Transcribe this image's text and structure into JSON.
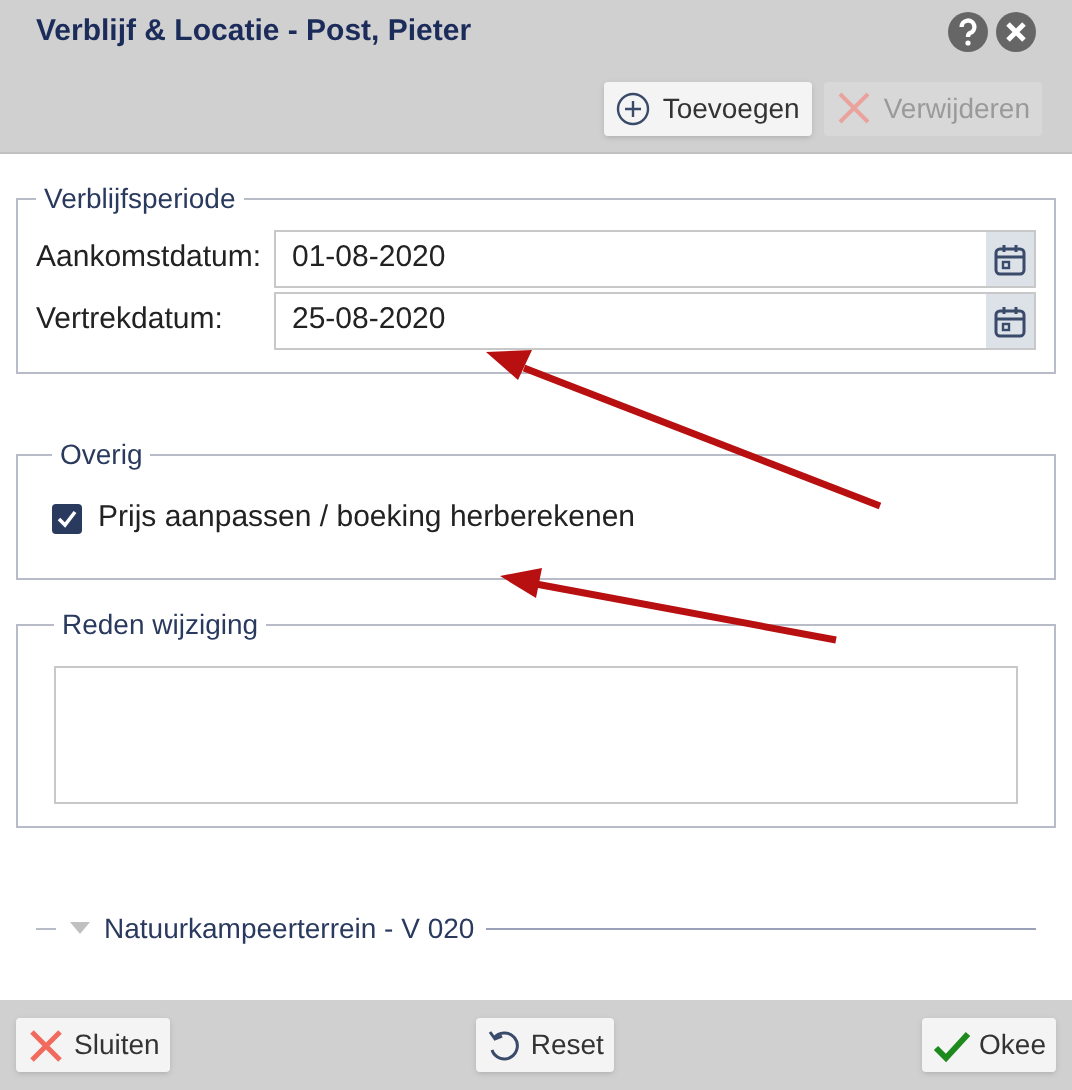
{
  "window": {
    "title": "Verblijf & Locatie - Post, Pieter"
  },
  "toolbar": [
    {
      "label": "Toevoegen",
      "kind": "add",
      "disabled": false
    },
    {
      "label": "Verwijderen",
      "kind": "delete",
      "disabled": true
    }
  ],
  "stay_period": {
    "legend": "Verblijfsperiode",
    "fields": [
      {
        "label": "Aankomstdatum:",
        "value": "01-08-2020"
      },
      {
        "label": "Vertrekdatum:",
        "value": "25-08-2020"
      }
    ]
  },
  "other": {
    "legend": "Overig",
    "checkbox": {
      "label": "Prijs aanpassen / boeking herberekenen",
      "checked": true
    }
  },
  "reason": {
    "legend": "Reden wijziging"
  },
  "section": {
    "label": "Natuurkampeerterrein - V 020",
    "expanded": false
  },
  "footer": [
    {
      "label": "Sluiten",
      "kind": "close"
    },
    {
      "label": "Reset",
      "kind": "reset"
    },
    {
      "label": "Okee",
      "kind": "ok"
    }
  ]
}
